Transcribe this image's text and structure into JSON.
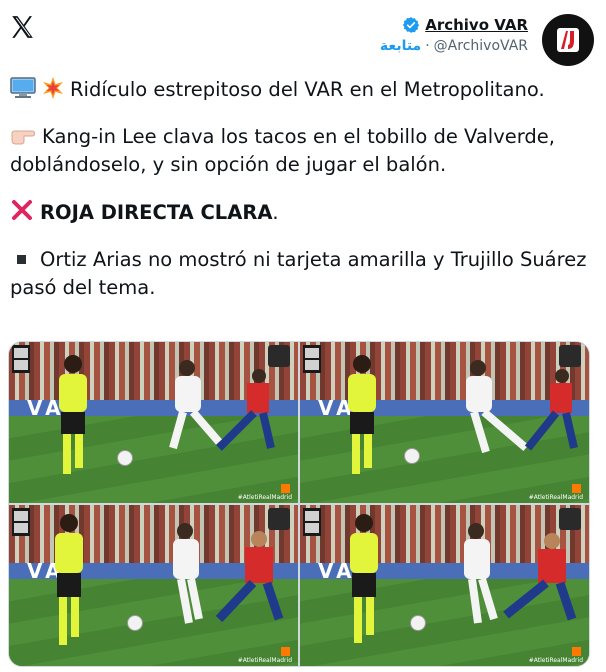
{
  "header": {
    "display_name": "Archivo VAR",
    "handle": "@ArchivoVAR",
    "separator": "·",
    "follow_label": "متابعة"
  },
  "tweet": {
    "line1": "Ridículo estrepitoso del VAR en el Metropolitano.",
    "line2": "Kang-in Lee clava los tacos en el tobillo de Valverde, doblándoselo, y sin opción de jugar el balón.",
    "line3_bold": "ROJA DIRECTA CLARA",
    "line3_end": ".",
    "line4": "Ortiz Arias no mostró ni tarjeta amarilla y Trujillo Suárez pasó del tema."
  },
  "media": {
    "board_text": "VAR",
    "hashtag": "#AtletiRealMadrid",
    "frames": [
      {
        "label": "frame-1"
      },
      {
        "label": "frame-2"
      },
      {
        "label": "frame-3"
      },
      {
        "label": "frame-4"
      }
    ]
  },
  "colors": {
    "accent": "#1d9bf0",
    "text": "#0f1419",
    "secondary": "#536471",
    "red_x": "#e0245e",
    "referee_shirt": "#e3f53a"
  },
  "icons": [
    "x-logo-icon",
    "verified-badge-icon",
    "computer-icon",
    "collision-icon",
    "pointing-hand-icon",
    "red-cross-icon",
    "black-square-icon"
  ]
}
